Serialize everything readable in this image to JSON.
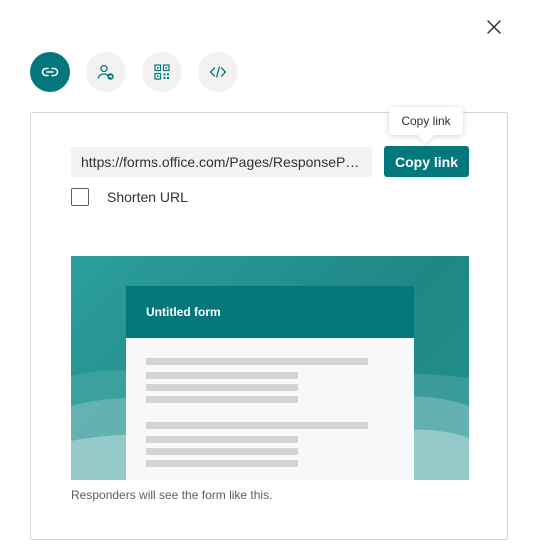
{
  "dialog": {
    "close_icon": "close-icon"
  },
  "share_tabs": [
    {
      "name": "link-icon",
      "active": true
    },
    {
      "name": "share-people-icon",
      "active": false
    },
    {
      "name": "qr-code-icon",
      "active": false
    },
    {
      "name": "embed-code-icon",
      "active": false
    }
  ],
  "link": {
    "url": "https://forms.office.com/Pages/ResponsePag...",
    "copy_label": "Copy link",
    "tooltip": "Copy link",
    "shorten_label": "Shorten URL",
    "shorten_checked": false
  },
  "preview": {
    "form_title": "Untitled form",
    "caption": "Responders will see the form like this."
  },
  "colors": {
    "accent": "#03787c",
    "tab_bg": "#f3f2f1",
    "preview_bg": "#1f8886"
  }
}
